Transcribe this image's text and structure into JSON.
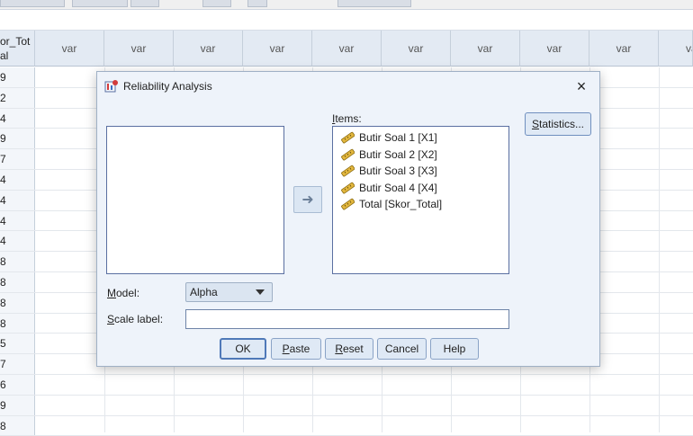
{
  "grid": {
    "first_column_header": [
      "or_Tot",
      "al"
    ],
    "var_header": "var",
    "row_values": [
      "9",
      "2",
      "4",
      "9",
      "7",
      "4",
      "4",
      "4",
      "4",
      "8",
      "8",
      "8",
      "8",
      "5",
      "7",
      "6",
      "9",
      "8"
    ]
  },
  "dialog": {
    "title": "Reliability Analysis",
    "close_symbol": "×",
    "items_label": "Items:",
    "items": [
      "Butir Soal 1 [X1]",
      "Butir Soal 2 [X2]",
      "Butir Soal 3 [X3]",
      "Butir Soal 4 [X4]",
      "Total [Skor_Total]"
    ],
    "move_symbol": "➜",
    "statistics_button": "Statistics...",
    "model_label": "Model:",
    "model_value": "Alpha",
    "scale_label": "Scale label:",
    "scale_value": "",
    "buttons": {
      "ok": "OK",
      "paste": "Paste",
      "reset": "Reset",
      "cancel": "Cancel",
      "help": "Help"
    }
  },
  "colors": {
    "dialog_bg": "#eef3fa",
    "header_bg": "#e3eaf3",
    "accent_border": "#4f79b8"
  }
}
